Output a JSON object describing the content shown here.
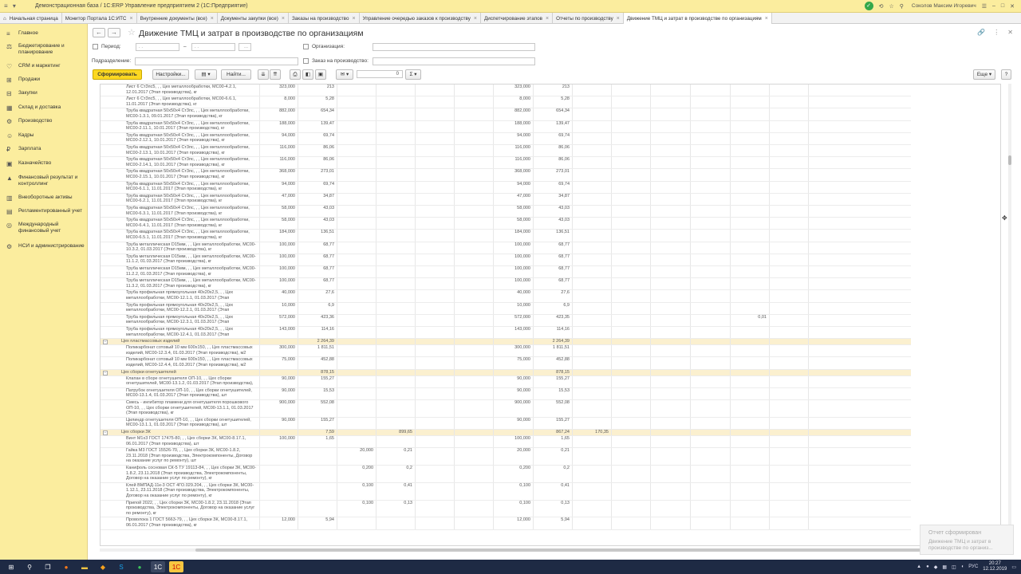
{
  "topbar": {
    "app_title": "Демонстрационная база / 1С:ERP Управление предприятием 2  (1С:Предприятие)",
    "user": "Соколов Максим Игоревич"
  },
  "tabs": [
    {
      "label": "Начальная страница"
    },
    {
      "label": "Монитор Портала 1С:ИТС"
    },
    {
      "label": "Внутренние документы (все)"
    },
    {
      "label": "Документы закупки (все)"
    },
    {
      "label": "Заказы на производство"
    },
    {
      "label": "Управление очередью заказов к производству"
    },
    {
      "label": "Диспетчирование этапов"
    },
    {
      "label": "Отчеты по производству"
    },
    {
      "label": "Движение ТМЦ и затрат в производстве по организациям"
    }
  ],
  "sidebar": [
    {
      "label": "Главное",
      "icon": "menu-icon"
    },
    {
      "label": "Бюджетирование и планирование",
      "icon": "budget-icon"
    },
    {
      "label": "CRM и маркетинг",
      "icon": "crm-icon"
    },
    {
      "label": "Продажи",
      "icon": "sales-icon"
    },
    {
      "label": "Закупки",
      "icon": "purchase-icon"
    },
    {
      "label": "Склад и доставка",
      "icon": "warehouse-icon"
    },
    {
      "label": "Производство",
      "icon": "factory-icon"
    },
    {
      "label": "Кадры",
      "icon": "people-icon"
    },
    {
      "label": "Зарплата",
      "icon": "salary-icon"
    },
    {
      "label": "Казначейство",
      "icon": "treasury-icon"
    },
    {
      "label": "Финансовый результат и контроллинг",
      "icon": "chart-icon"
    },
    {
      "label": "Внеоборотные активы",
      "icon": "assets-icon"
    },
    {
      "label": "Регламентированный учет",
      "icon": "ledger-icon"
    },
    {
      "label": "Международный финансовый учет",
      "icon": "globe-icon"
    },
    {
      "label": "НСИ и администрирование",
      "icon": "gear-icon"
    }
  ],
  "report": {
    "title": "Движение ТМЦ и затрат в производстве по организациям",
    "period_label": "Период:",
    "period_sep": "–",
    "organization_label": "Организация:",
    "department_label": "Подразделение:",
    "production_order_label": "Заказ на производство:",
    "generate_button": "Сформировать",
    "settings_button": "Настройки...",
    "find_button": "Найти...",
    "more_button": "Еще",
    "help_button": "?",
    "sum_value": "0"
  },
  "rows": [
    {
      "name": "Лист 6 Ст3пс5, , , Цех металлообработки, МС00-4.2.1, 12.01.2017 (Этап производства), кг",
      "c1": "323,000",
      "c2": "213",
      "c7": "323,000",
      "c8": "213"
    },
    {
      "name": "Лист 6 Ст3пс5, , , Цех металлообработки, МС00-6.6.1, 11.01.2017 (Этап производства), кг",
      "c1": "8,000",
      "c2": "5,28",
      "c7": "8,000",
      "c8": "5,28"
    },
    {
      "name": "Труба квадратная 50х50х4 Ст3пс, , , Цех металлообработки, МС00-1.3.1, 09.01.2017 (Этап производства), кг",
      "c1": "882,000",
      "c2": "654,34",
      "c7": "882,000",
      "c8": "654,34"
    },
    {
      "name": "Труба квадратная 50х50х4 Ст3пс, , , Цех металлообработки, МС00-2.11.1, 10.01.2017 (Этап производства), кг",
      "c1": "188,000",
      "c2": "139,47",
      "c7": "188,000",
      "c8": "139,47"
    },
    {
      "name": "Труба квадратная 50х50х4 Ст3пс, , , Цех металлообработки, МС00-2.12.1, 10.01.2017 (Этап производства), кг",
      "c1": "94,000",
      "c2": "69,74",
      "c7": "94,000",
      "c8": "69,74"
    },
    {
      "name": "Труба квадратная 50х50х4 Ст3пс, , , Цех металлообработки, МС00-2.13.1, 10.01.2017 (Этап производства), кг",
      "c1": "116,000",
      "c2": "86,06",
      "c7": "116,000",
      "c8": "86,06"
    },
    {
      "name": "Труба квадратная 50х50х4 Ст3пс, , , Цех металлообработки, МС00-2.14.1, 10.01.2017 (Этап производства), кг",
      "c1": "116,000",
      "c2": "86,06",
      "c7": "116,000",
      "c8": "86,06"
    },
    {
      "name": "Труба квадратная 50х50х4 Ст3пс, , , Цех металлообработки, МС00-2.15.1, 10.01.2017 (Этап производства), кг",
      "c1": "368,000",
      "c2": "273,01",
      "c7": "368,000",
      "c8": "273,01"
    },
    {
      "name": "Труба квадратная 50х50х4 Ст3пс, , , Цех металлообработки, МС00-6.1.1, 11.01.2017 (Этап производства), кг",
      "c1": "94,000",
      "c2": "69,74",
      "c7": "94,000",
      "c8": "69,74"
    },
    {
      "name": "Труба квадратная 50х50х4 Ст3пс, , , Цех металлообработки, МС00-6.2.1, 11.01.2017 (Этап производства), кг",
      "c1": "47,000",
      "c2": "34,87",
      "c7": "47,000",
      "c8": "34,87"
    },
    {
      "name": "Труба квадратная 50х50х4 Ст3пс, , , Цех металлообработки, МС00-6.3.1, 11.01.2017 (Этап производства), кг",
      "c1": "58,000",
      "c2": "43,03",
      "c7": "58,000",
      "c8": "43,03"
    },
    {
      "name": "Труба квадратная 50х50х4 Ст3пс, , , Цех металлообработки, МС00-6.4.1, 11.01.2017 (Этап производства), кг",
      "c1": "58,000",
      "c2": "43,03",
      "c7": "58,000",
      "c8": "43,03"
    },
    {
      "name": "Труба квадратная 50х50х4 Ст3пс, , , Цех металлообработки, МС00-6.5.1, 11.01.2017 (Этап производства), кг",
      "c1": "184,000",
      "c2": "136,51",
      "c7": "184,000",
      "c8": "136,51"
    },
    {
      "name": "Труба металлическая D15мм, , , Цех металлообработки, МС00-10.3.2, 01.03.2017 (Этап производства), кг",
      "c1": "100,000",
      "c2": "68,77",
      "c7": "100,000",
      "c8": "68,77"
    },
    {
      "name": "Труба металлическая D15мм, , , Цех металлообработки, МС00-11.1.2, 01.03.2017 (Этап производства), кг",
      "c1": "100,000",
      "c2": "68,77",
      "c7": "100,000",
      "c8": "68,77"
    },
    {
      "name": "Труба металлическая D15мм, , , Цех металлообработки, МС00-11.2.2, 01.03.2017 (Этап производства), кг",
      "c1": "100,000",
      "c2": "68,77",
      "c7": "100,000",
      "c8": "68,77"
    },
    {
      "name": "Труба металлическая D15мм, , , Цех металлообработки, МС00-11.3.2, 01.03.2017 (Этап производства), кг",
      "c1": "100,000",
      "c2": "68,77",
      "c7": "100,000",
      "c8": "68,77"
    },
    {
      "name": "Труба профильная прямоугольная 40х20х2,5, , , Цех металлообработки, МС00-12.1.1, 01.03.2017 (Этап производства), кг",
      "c1": "40,000",
      "c2": "27,6",
      "c7": "40,000",
      "c8": "27,6"
    },
    {
      "name": "Труба профильная прямоугольная 40х20х2,5, , , Цех металлообработки, МС00-12.2.1, 01.03.2017 (Этап производства), кг",
      "c1": "10,000",
      "c2": "6,9",
      "c7": "10,000",
      "c8": "6,9"
    },
    {
      "name": "Труба профильная прямоугольная 40х20х2,5, , , Цех металлообработки, МС00-12.3.1, 01.03.2017 (Этап производства), кг",
      "c1": "572,000",
      "c2": "423,36",
      "c7": "572,000",
      "c8": "423,35",
      "c13": "0,01"
    },
    {
      "name": "Труба профильная прямоугольная 40х20х2,5, , , Цех металлообработки, МС00-12.4.1, 01.03.2017 (Этап производства), кг",
      "c1": "143,000",
      "c2": "114,16",
      "c7": "143,000",
      "c8": "114,16"
    },
    {
      "group": true,
      "name": "Цех пластмассовых изделий",
      "c2": "2 264,39",
      "c8": "2 264,39"
    },
    {
      "name": "Поликарбонат сотовый 10 мм 600х150, , , Цех пластмассовых изделий, МС00-12.3.4, 01.03.2017 (Этап производства), м2",
      "c1": "300,000",
      "c2": "1 811,51",
      "c7": "300,000",
      "c8": "1 811,51"
    },
    {
      "name": "Поликарбонат сотовый 10 мм 600х150, , , Цех пластмассовых изделий, МС00-12.4.4, 01.03.2017 (Этап производства), м2",
      "c1": "75,000",
      "c2": "452,88",
      "c7": "75,000",
      "c8": "452,88"
    },
    {
      "group": true,
      "name": "Цех сборки огнетушителей",
      "c2": "878,15",
      "c8": "878,15"
    },
    {
      "name": "Клапан в сборе огнетушителя ОП-10, , , Цех сборки огнетушителей, МС00-13.1.2, 01.03.2017 (Этап производства), шт",
      "c1": "90,000",
      "c2": "155,27",
      "c7": "90,000",
      "c8": "155,27"
    },
    {
      "name": "Патрубок огнетушителя ОП-10, , , Цех сборки огнетушителей, МС00-13.1.4, 01.03.2017 (Этап производства), шт",
      "c1": "90,000",
      "c2": "15,53",
      "c7": "90,000",
      "c8": "15,53"
    },
    {
      "name": "Смесь - ингибитор пламени для огнетушителя порошкового ОП-10, , , Цех сборки огнетушителей, МС00-13.1.1, 01.03.2017 (Этап производства), кг",
      "c1": "900,000",
      "c2": "552,08",
      "c7": "900,000",
      "c8": "552,08"
    },
    {
      "name": "Цилиндр огнетушителя ОП-10, , , Цех сборки огнетушителей, МС00-13.1.1, 01.03.2017 (Этап производства), шт",
      "c1": "90,000",
      "c2": "155,27",
      "c7": "90,000",
      "c8": "155,27"
    },
    {
      "group": true,
      "name": "Цех сборки ЗК",
      "c2": "7,59",
      "c4": "899,65",
      "c8": "867,24",
      "c9": "170,35"
    },
    {
      "name": "Винт М1х3 ГОСТ 17475-80, , , Цех сборки ЗК, МС00-8.17.1, 06.01.2017 (Этап производства), шт",
      "c1": "100,000",
      "c2": "1,65",
      "c7": "100,000",
      "c8": "1,65"
    },
    {
      "name": "Гайка М3 ГОСТ 15526-70, , , Цех сборки ЗК, МС00-1.8.2, 23.11.2018 (Этап производства, Электрокомпоненты, Договор на оказание услуг по ремонту), шт",
      "c3": "20,000",
      "c4": "0,21",
      "c7": "20,000",
      "c8": "0,21"
    },
    {
      "name": "Канифоль сосновая СК-5 ТУ 19113-84, , , Цех сборки ЗК, МС00-1.8.2, 23.11.2018 (Этап производства, Электрокомпоненты, Договор на оказание услуг по ремонту), кг",
      "c3": "0,200",
      "c4": "0,2",
      "c7": "0,200",
      "c8": "0,2"
    },
    {
      "name": "Клей ВМПАД-11к-3 ОСТ 4ГО.029.204, , , Цех сборки ЗК, МС00-1.12.1, 23.11.2018 (Этап производства, Электрокомпоненты, Договор на оказание услуг по ремонту), кг",
      "c3": "0,100",
      "c4": "0,41",
      "c7": "0,100",
      "c8": "0,41"
    },
    {
      "name": "Припой 2022, , , Цех сборки ЗК, МС00-1.8.2, 23.11.2018 (Этап производства, Электрокомпоненты, Договор на оказание услуг по ремонту), кг",
      "c3": "0,100",
      "c4": "0,13",
      "c7": "0,100",
      "c8": "0,13"
    },
    {
      "name": "Проволока 1 ГОСТ 5663-79, , , Цех сборки ЗК, МС00-8.17.1, 06.01.2017 (Этап производства), кг",
      "c1": "12,000",
      "c2": "5,94",
      "c7": "12,000",
      "c8": "5,94"
    }
  ],
  "notification": {
    "title": "Отчет сформирован",
    "text": "Движение ТМЦ и затрат в производстве по организ..."
  },
  "taskbar": {
    "lang": "РУС",
    "time": "20:27",
    "date": "12.12.2019"
  }
}
